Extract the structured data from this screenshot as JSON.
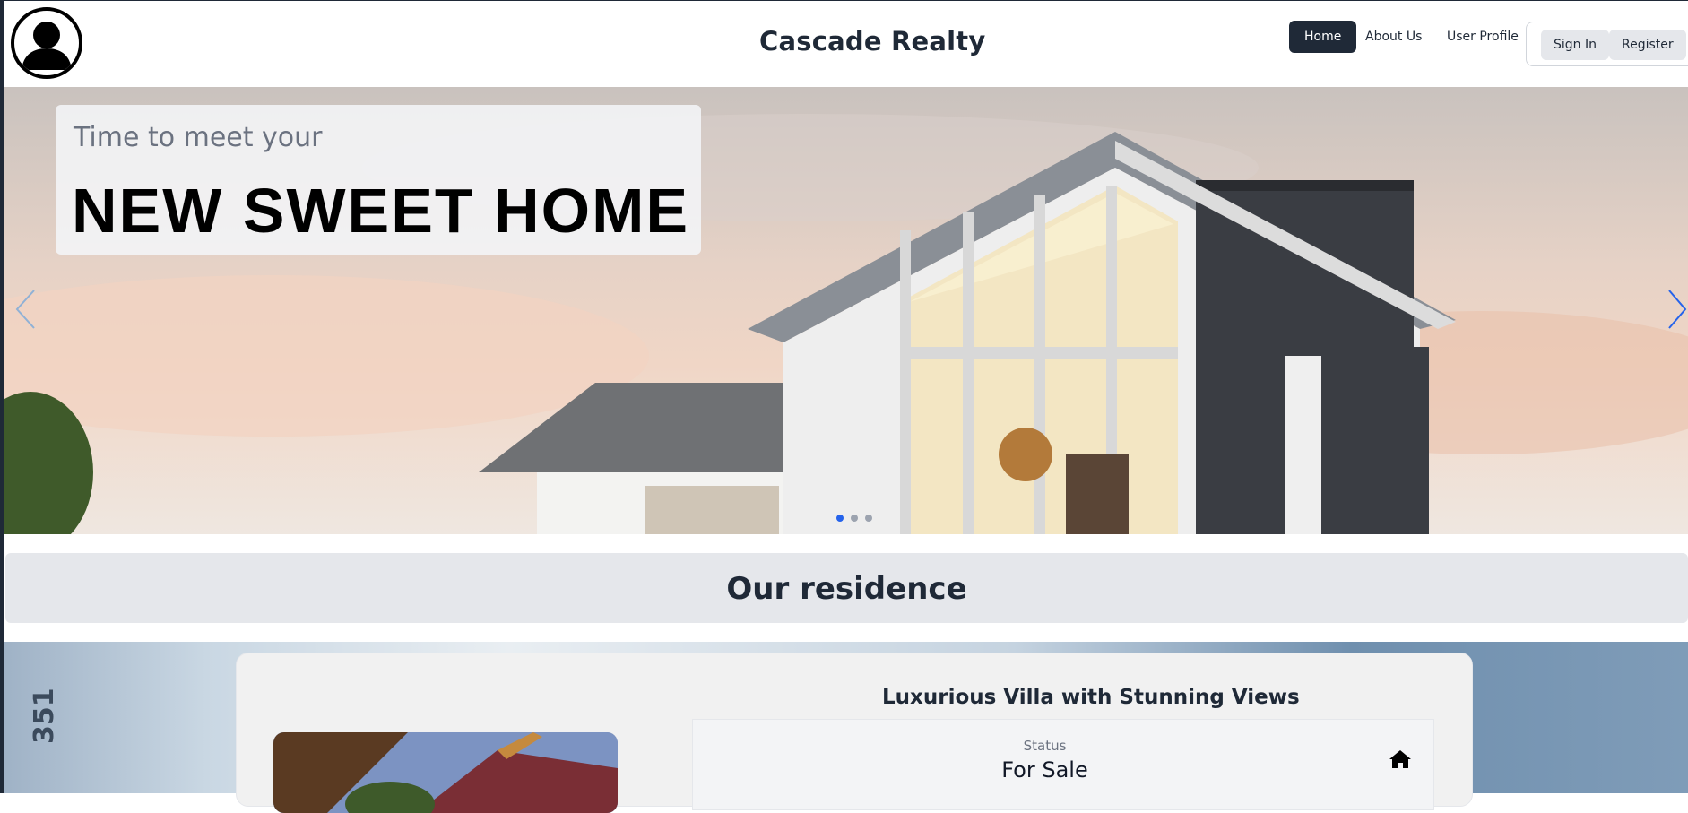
{
  "header": {
    "brand": "Cascade Realty",
    "nav": [
      {
        "label": "Home",
        "active": true
      },
      {
        "label": "About Us",
        "active": false
      },
      {
        "label": "User Profile",
        "active": false
      }
    ],
    "auth": {
      "sign_in": "Sign In",
      "register": "Register"
    },
    "avatar_icon": "user-avatar-icon"
  },
  "hero": {
    "kicker": "Time to meet your",
    "title": "NEW SWEET HOME",
    "slides": 3,
    "active_slide": 1,
    "prev_icon": "chevron-left-icon",
    "next_icon": "chevron-right-icon"
  },
  "section": {
    "title": "Our residence"
  },
  "listing": {
    "side_text": "351",
    "title": "Luxurious Villa with Stunning Views",
    "status_label": "Status",
    "status_value": "For Sale",
    "status_icon": "home-icon"
  },
  "colors": {
    "nav_active_bg": "#1f2937",
    "accent": "#2563eb",
    "section_bg": "#e5e7eb"
  }
}
